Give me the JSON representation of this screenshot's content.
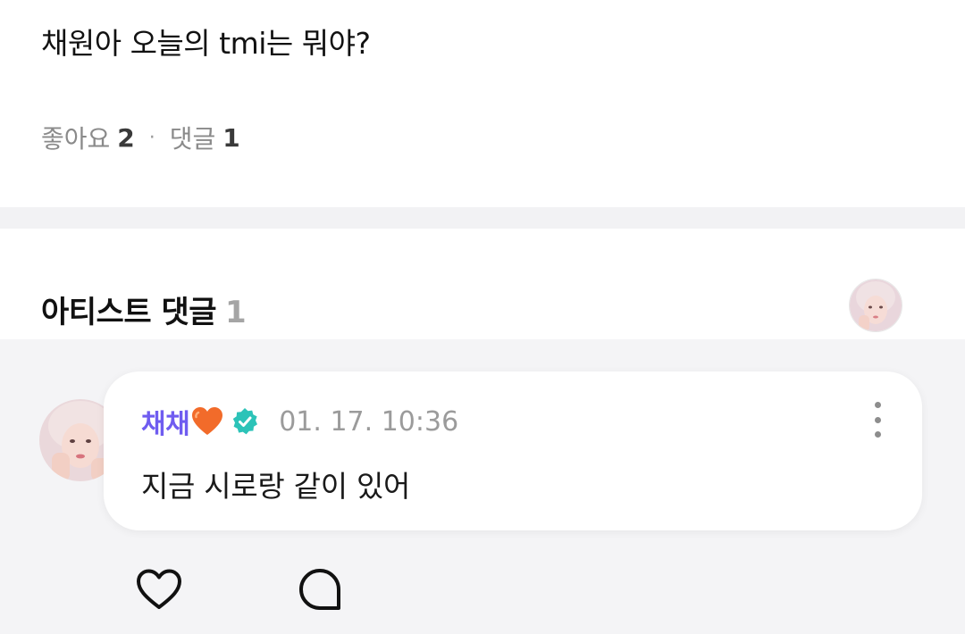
{
  "post": {
    "text": "채원아 오늘의 tmi는 뭐야?",
    "likes_label": "좋아요",
    "likes_count": "2",
    "separator": "·",
    "comments_label": "댓글",
    "comments_count": "1"
  },
  "artist_section": {
    "title": "아티스트 댓글",
    "count": "1"
  },
  "comment": {
    "author": "채채",
    "author_emoji": "orange-heart-icon",
    "verified_icon": "verified-badge-icon",
    "timestamp": "01. 17. 10:36",
    "text": "지금 시로랑 같이 있어",
    "more_icon": "more-vertical-icon"
  },
  "actions": {
    "like_icon": "heart-outline-icon",
    "reply_icon": "chat-bubble-icon"
  },
  "colors": {
    "author": "#6f5cf0",
    "verified": "#2cc3b8",
    "heart": "#f26b2a",
    "muted": "#9b9b9b",
    "comment_bg": "#f4f4f6"
  }
}
